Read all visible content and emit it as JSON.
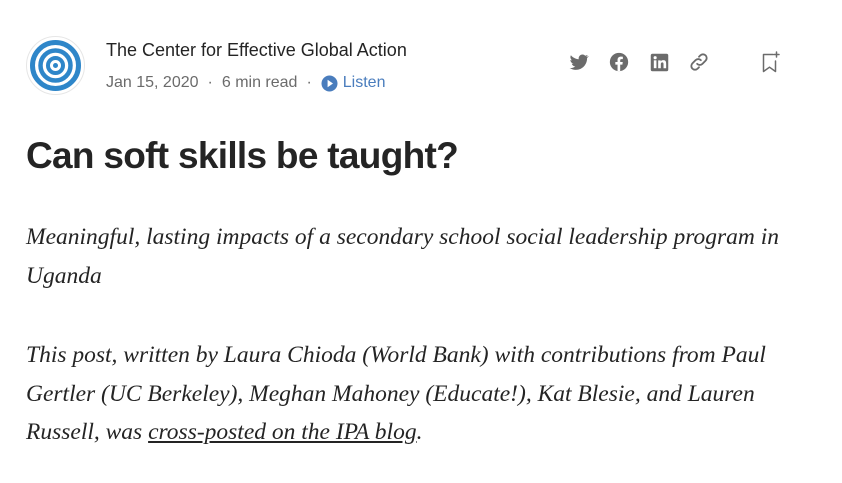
{
  "header": {
    "author": "The Center for Effective Global Action",
    "date": "Jan 15, 2020",
    "separator": "·",
    "read_time": "6 min read",
    "listen_label": "Listen",
    "avatar_icon": "cega-logo-icon",
    "accent_color": "#2e86c9"
  },
  "share_icons": [
    "twitter-icon",
    "facebook-icon",
    "linkedin-icon",
    "link-icon",
    "bookmark-add-icon"
  ],
  "article": {
    "title": "Can soft skills be taught?",
    "subtitle": "Meaningful, lasting impacts of a secondary school social leadership program in Uganda",
    "intro_before_link": "This post, written by Laura Chioda (World Bank) with contributions from Paul Gertler (UC Berkeley), Meghan Mahoney (Educate!), Kat Blesie, and Lauren Russell, was ",
    "intro_link": "cross-posted on the IPA blog",
    "intro_after_link": "."
  }
}
